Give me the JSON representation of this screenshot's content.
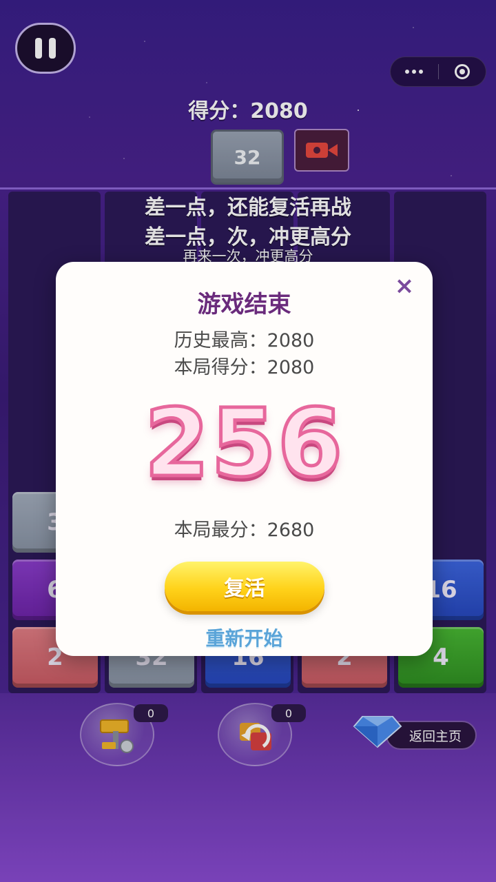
{
  "top_bar": {
    "score_label": "得分：2080",
    "next_tile_value": "32"
  },
  "colors": {
    "gray_tile": "#8d97a8",
    "purple_tile": "#7b2db8",
    "red_tile": "#d56a72",
    "blue_tile": "#2f58d6",
    "green_tile": "#3aa52a",
    "modal_bg": "#fffdfb",
    "title_color": "#6a2b7c",
    "revive_button": "#ffd21a"
  },
  "board_hint": {
    "line1": "差一点，还能复活再战",
    "line2": "差一点，次，冲更高分",
    "line3": "再来一次，冲更高分"
  },
  "board": {
    "tiles": [
      {
        "value": "3",
        "color": "gray"
      },
      {
        "value": "6",
        "color": "purple"
      },
      {
        "value": "16",
        "color": "blue"
      },
      {
        "value": "2",
        "color": "red"
      },
      {
        "value": "32",
        "color": "gray"
      },
      {
        "value": "16",
        "color": "blue"
      },
      {
        "value": "2",
        "color": "red"
      },
      {
        "value": "4",
        "color": "green"
      }
    ]
  },
  "modal": {
    "title": "游戏结束",
    "history_best": "历史最高：2080",
    "this_round_score": "本局得分：2080",
    "big_number": "256",
    "this_round_max": "本局最分：2680",
    "revive_label": "复活",
    "restart_label": "重新开始",
    "close_icon": "close-icon"
  },
  "tools": {
    "hammer_count": "0",
    "undo_count": "0",
    "home_label": "返回主页"
  },
  "icons": [
    "pause-icon",
    "more-dots-icon",
    "target-icon",
    "video-icon",
    "hammer-icon",
    "undo-icon",
    "diamond-icon",
    "close-icon"
  ]
}
